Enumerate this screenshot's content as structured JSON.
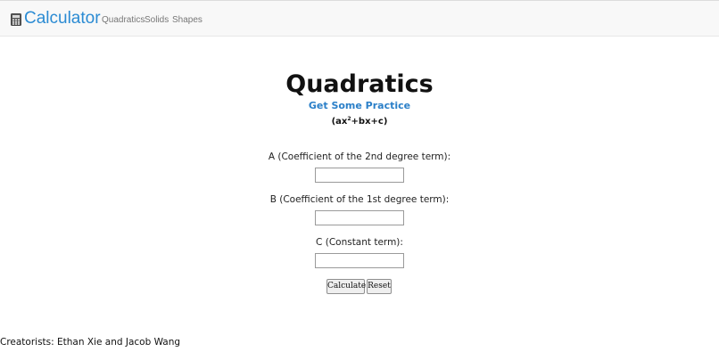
{
  "navbar": {
    "brand": "Calculator",
    "brand_icon": "calculator-icon",
    "links": [
      "Quadratics",
      "Solids",
      "Shapes"
    ],
    "brand_color": "#2b8bd3"
  },
  "main": {
    "title": "Quadratics",
    "practice_link": "Get Some Practice",
    "formula": {
      "prefix": "(ax",
      "exponent": "2",
      "suffix": "+bx+c)"
    },
    "fields": [
      {
        "label": "A (Coefficient of the 2nd degree term):",
        "value": "",
        "placeholder": ""
      },
      {
        "label": "B (Coefficient of the 1st degree term):",
        "value": "",
        "placeholder": ""
      },
      {
        "label": "C (Constant term):",
        "value": "",
        "placeholder": ""
      }
    ],
    "buttons": {
      "calculate": "Calculate",
      "reset": "Reset"
    },
    "link_color": "#2a7fc8"
  },
  "footer": {
    "credits": "Creatorists: Ethan Xie and Jacob Wang"
  }
}
